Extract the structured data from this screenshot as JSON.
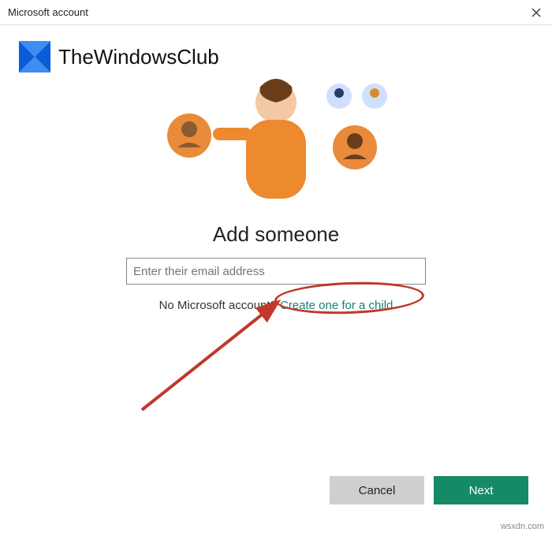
{
  "window": {
    "title": "Microsoft account"
  },
  "watermark": {
    "text": "TheWindowsClub"
  },
  "heading": "Add someone",
  "email": {
    "value": "",
    "placeholder": "Enter their email address"
  },
  "sub": {
    "prefix": "No Microsoft account?",
    "link": "Create one for a child"
  },
  "buttons": {
    "cancel": "Cancel",
    "next": "Next"
  },
  "attribution": "wsxdn.com",
  "colors": {
    "accent": "#158a66",
    "link": "#1a7f6e",
    "annotation": "#c0392b",
    "brand_blue": "#0a5cd8"
  }
}
